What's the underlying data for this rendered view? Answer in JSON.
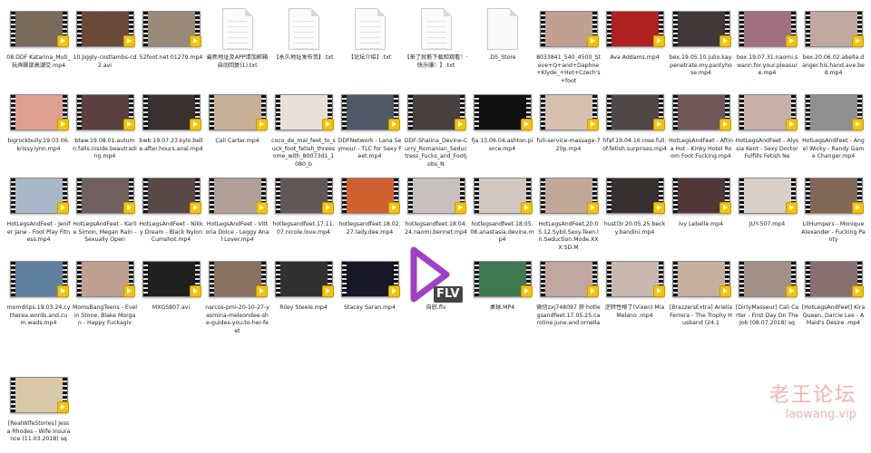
{
  "files": [
    [
      {
        "label": "08.DDF Katarina_Muti_玩弄脚部高潮交.mp4",
        "type": "video",
        "color": "#7a6a5a"
      },
      {
        "label": "10.Jiggly-costlambs-cd2.avi",
        "type": "video",
        "color": "#6b4a3a"
      },
      {
        "label": "52foot.net 01279.mp4",
        "type": "video",
        "color": "#9a8a7a"
      },
      {
        "label": "最新地址及APP请加邮箱自动回复(1).txt",
        "type": "doc"
      },
      {
        "label": "【永久地址发布页】.txt",
        "type": "doc"
      },
      {
        "label": "【论坛介绍】.txt",
        "type": "doc"
      },
      {
        "label": "【来了就能下载和观看！·快乐赚！】.txt",
        "type": "doc"
      },
      {
        "label": ".DS_Store",
        "type": "blank"
      },
      {
        "label": "8033841_540_4500_Steve+Q+and+Daphne+Klyde_+Hot+Czech's+foot",
        "type": "video",
        "color": "#c0a090"
      },
      {
        "label": "Ava Addams.mp4",
        "type": "video",
        "color": "#b02020"
      },
      {
        "label": "bex.19.05.10.julio.kay.penetrate.my.pantyhose.mp4",
        "type": "video",
        "color": "#403838"
      },
      {
        "label": "bex.19.07.31.naomi.swann.for.your.pleasure.mp4",
        "type": "video",
        "color": "#a07080"
      },
      {
        "label": "bex.20.06.02.abella.danger.his.hand.ave.bed.mp4",
        "type": "video",
        "color": "#c0a8a0"
      }
    ],
    [
      {
        "label": "bigrockbully.19.03.06.krissy.lynn.mp4",
        "type": "video",
        "color": "#e0a090"
      },
      {
        "label": "btaw.19.08.01.autumn.falls.inside.beautrading.mp4",
        "type": "video",
        "color": "#5a4040"
      },
      {
        "label": "bwb.19.07.23.kylo.belle.after.hours.anal.mp4",
        "type": "video",
        "color": "#3a3030"
      },
      {
        "label": "Cali Carter.mp4",
        "type": "video",
        "color": "#c8b098"
      },
      {
        "label": "coco_de_mal_feet_to_suck_foot_fetish_threesome_with_80073d1_1080_b",
        "type": "video",
        "color": "#e8e0d8"
      },
      {
        "label": "DDFNetwork - Lana Seymour - TLC for Sexy Feet.mp4",
        "type": "video",
        "color": "#505868"
      },
      {
        "label": "DDF-Shalina_Devine-Curry_Romanian_Seductress_Fucks_and_Footjobs_N",
        "type": "video",
        "color": "#484040"
      },
      {
        "label": "fja.13.06.04.ashton.pierce.mp4",
        "type": "video",
        "color": "#101010"
      },
      {
        "label": "full-service-massage-720p.mp4",
        "type": "video",
        "color": "#d8c0b0"
      },
      {
        "label": "hfaf.19.04.16.rose.full.of.fetish.surprises.mp4",
        "type": "video",
        "color": "#504848"
      },
      {
        "label": "HotLegsAndFeet - Aftina Hot - Kinky Hotel Room Foot Fucking.mp4",
        "type": "video",
        "color": "#705858"
      },
      {
        "label": "HotLegsAndFeet - Alyssia Kent - Sexy Doctor Fulfills Fetish Ne",
        "type": "video",
        "color": "#c8b0a8"
      },
      {
        "label": "HotLegsAndFeet - Angel Wicky - Randy Game Changer.mp4",
        "type": "video",
        "color": "#909090"
      }
    ],
    [
      {
        "label": "HotLegsAndFeet - Jenifer Jane - Foot Play Fitness.mp4",
        "type": "video",
        "color": "#a8b8c8"
      },
      {
        "label": "HotLegsAndFeet - Karlie Simon, Megan Rain - Sexually Open",
        "type": "video",
        "color": "#706060"
      },
      {
        "label": "HotLegsAndFeet - Nikky Dream - Black Nylon Cumshot.mp4",
        "type": "video",
        "color": "#584848"
      },
      {
        "label": "HotLegsAndFeet - Vittoria Dolce - Leggy Anal Lover.mp4",
        "type": "video",
        "color": "#b0a098"
      },
      {
        "label": "hotlegsandfeet.17.11.07.nicole.love.mp4",
        "type": "video",
        "color": "#605858"
      },
      {
        "label": "hotlegsandfeet.18.02.27.lady.dee.mp4",
        "type": "video",
        "color": "#d06030"
      },
      {
        "label": "hotlegsandfeet.18.04.24.naomi.bennet.mp4",
        "type": "video",
        "color": "#c8c0c0"
      },
      {
        "label": "hotlegsandfeet.18.05.08.anastasia.devine.mp4",
        "type": "video",
        "color": "#d0c8c0"
      },
      {
        "label": "HotLegsAndFeet.20.05.12.Sybil.Sexy.Teen.In.Seduction.Mode.XXX.SD.M",
        "type": "video",
        "color": "#c0a898"
      },
      {
        "label": "hustl3r.20.05.25.becky.bandini.mp4",
        "type": "video",
        "color": "#383030"
      },
      {
        "label": "Ivy Lebelle.mp4",
        "type": "video",
        "color": "#503838"
      },
      {
        "label": "JUY-507.mp4",
        "type": "video",
        "color": "#d8d0c8"
      },
      {
        "label": "LilHumpers - Monique Alexander - Fucking Panty",
        "type": "video",
        "color": "#806858"
      }
    ],
    [
      {
        "label": "momdrips.19.03.24.cytherea.words.and.cum.wads.mp4",
        "type": "video",
        "color": "#6080a0"
      },
      {
        "label": "MomsBangTeens - Evelin Stone, Blake Morgan - Happy Fuckagiv",
        "type": "video",
        "color": "#c0a090"
      },
      {
        "label": "MXGS807.avi",
        "type": "video",
        "color": "#202020"
      },
      {
        "label": "narcos-pmi-20-10-27-yasmina-meleondee-she-guides-you-to-her-feet",
        "type": "video",
        "color": "#8a7060"
      },
      {
        "label": "Riley Steele.mp4",
        "type": "video",
        "color": "#303030"
      },
      {
        "label": "Stacey Saran.mp4",
        "type": "video",
        "color": "#181828"
      },
      {
        "label": "自慰.flv",
        "type": "flv"
      },
      {
        "label": "桌球.MP4",
        "type": "video",
        "color": "#407850"
      },
      {
        "label": "微信zxj748097 获·hotlegsandfeet.17.05.25.caroline.june.and.ornella",
        "type": "video",
        "color": "#c0a8a0"
      },
      {
        "label": "逆转性格了(Vixen) Mia Melano .mp4",
        "type": "video",
        "color": "#c8b8b0"
      },
      {
        "label": "[BrazzersExtra] Ariella Ferrera - The Trophy Husband (24.1",
        "type": "video",
        "color": "#c8b0a0"
      },
      {
        "label": "[DirtyMasseur] Cali Carter - First Day On The Job (08.07.2018) sq",
        "type": "video",
        "color": "#a09088"
      },
      {
        "label": "[HotLegsAndFeet] Kira Queen, Darcie Lee - A Maid's Desire .mp4",
        "type": "video",
        "color": "#887070"
      }
    ],
    [
      {
        "label": "[RealWifeStories] Jessa Rhodes - Wife Insurance (11.03.2018) sq",
        "type": "video",
        "color": "#d8c8a8"
      }
    ]
  ],
  "flv_badge": "FLV",
  "watermark": {
    "line1": "老王论坛",
    "line2": "laowang.vip"
  },
  "colors": {
    "badge": "#f5c400",
    "flv_purple": "#a040c8",
    "watermark": "#f4b2b2"
  }
}
